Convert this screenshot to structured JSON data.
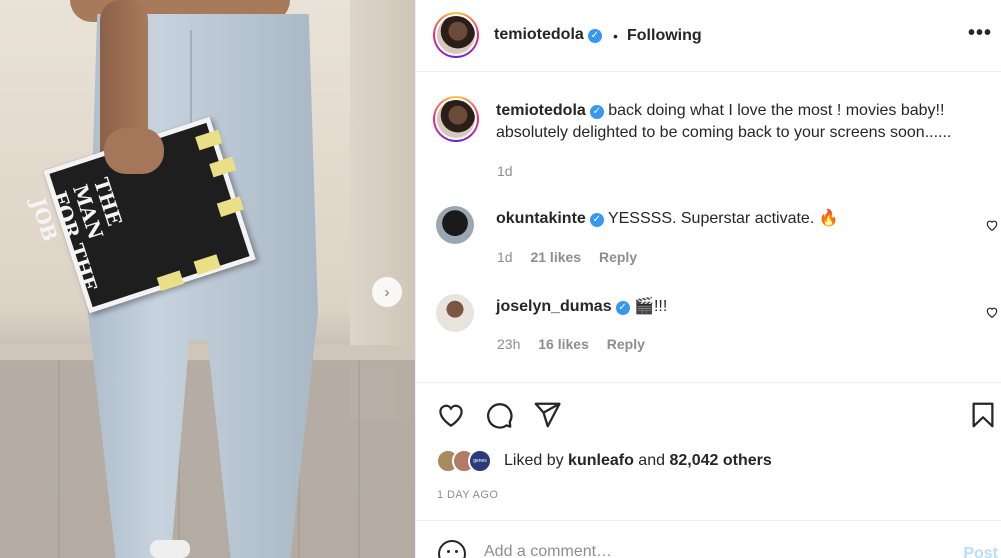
{
  "post": {
    "username": "temiotedola",
    "verified_mark": "✓",
    "follow_dot": "•",
    "follow_label": "Following",
    "more_label": "•••",
    "caption": "back doing what I love the most ! movies baby!! absolutely delighted to be coming back to your screens soon......",
    "caption_time": "1d"
  },
  "photo": {
    "book_title": "THE\nMAN\nFOR THE\nJOB",
    "next_arrow": "›"
  },
  "comments": [
    {
      "username": "okuntakinte",
      "text": "YESSSS. Superstar activate. 🔥",
      "time": "1d",
      "likes": "21 likes",
      "reply": "Reply"
    },
    {
      "username": "joselyn_dumas",
      "text": "🎬!!!",
      "time": "23h",
      "likes": "16 likes",
      "reply": "Reply"
    }
  ],
  "likes": {
    "prefix": "Liked by",
    "user": "kunleafo",
    "joiner": "and",
    "others": "82,042 others",
    "avatar_badge": "genes"
  },
  "posted_ago": "1 DAY AGO",
  "add_comment": {
    "placeholder": "Add a comment…",
    "post_label": "Post"
  },
  "icons": [
    "heart-icon",
    "comment-icon",
    "share-icon",
    "bookmark-icon",
    "emoji-icon",
    "more-icon",
    "chevron-right-icon"
  ],
  "colors": {
    "verified": "#3897f0",
    "post_button": "#b2dffc",
    "muted": "#8e8e8e",
    "text": "#262626"
  }
}
